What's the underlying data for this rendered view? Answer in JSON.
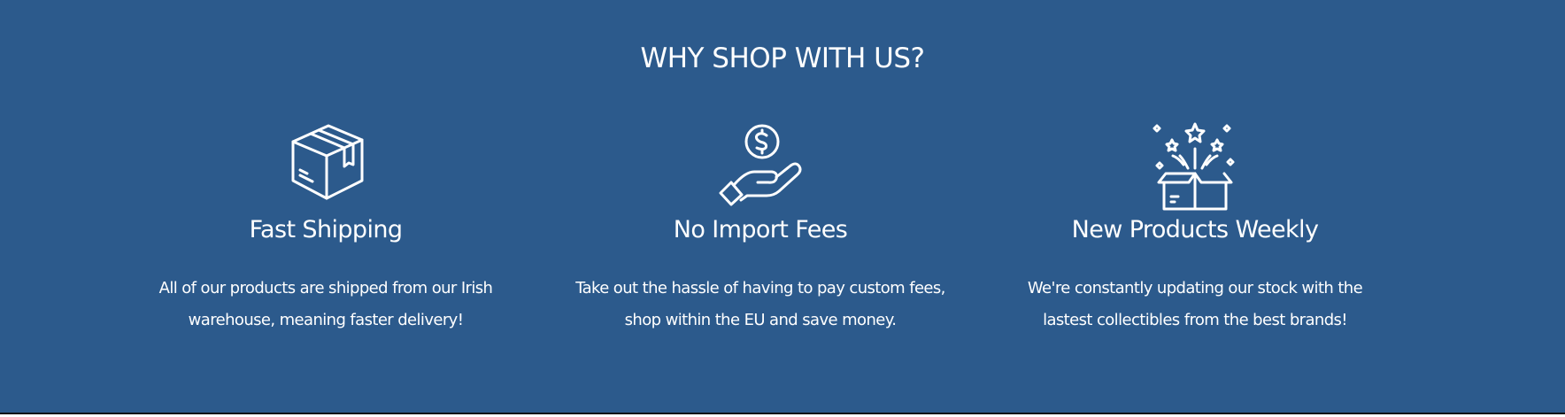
{
  "section": {
    "heading": "WHY SHOP WITH US?",
    "background_color": "#2c5a8c",
    "text_color": "#ffffff"
  },
  "features": [
    {
      "icon": "package-box-icon",
      "title": "Fast Shipping",
      "description": "All of our products are shipped from our Irish warehouse, meaning faster delivery!"
    },
    {
      "icon": "hand-coin-dollar-icon",
      "title": "No Import Fees",
      "description": "Take out the hassle of having to pay custom fees, shop within the EU and save money."
    },
    {
      "icon": "gift-box-stars-icon",
      "title": "New Products Weekly",
      "description": "We're constantly updating our stock with the lastest collectibles from the best brands!"
    }
  ]
}
